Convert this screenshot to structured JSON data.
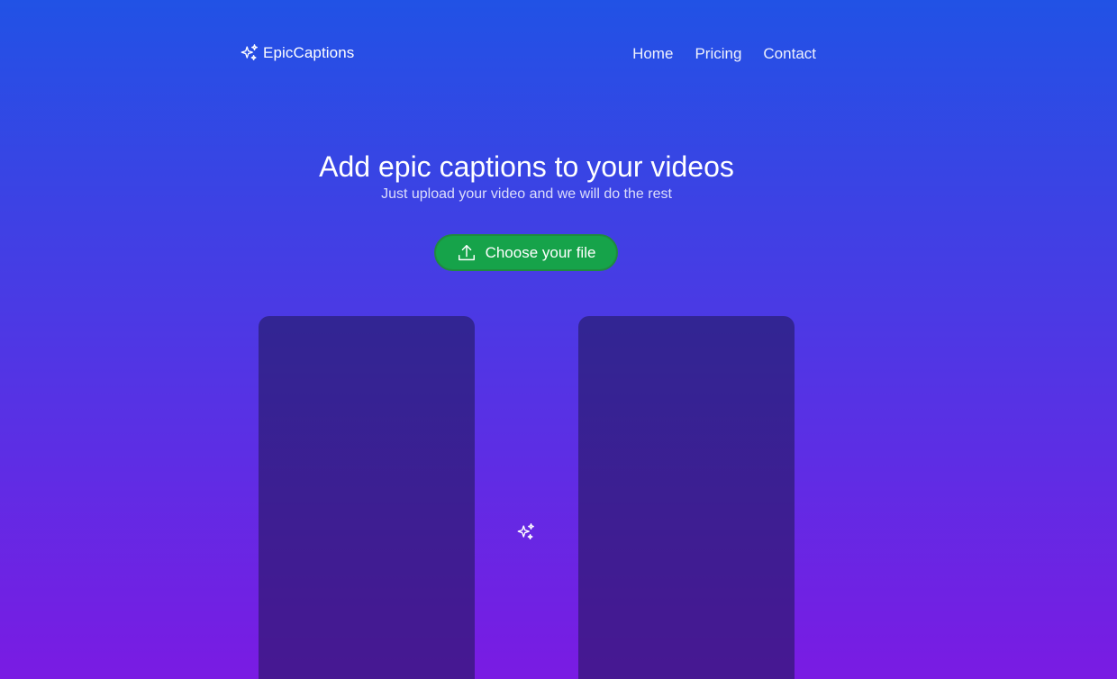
{
  "header": {
    "logo_icon": "sparkles-icon",
    "logo_text": "EpicCaptions",
    "nav": [
      {
        "label": "Home"
      },
      {
        "label": "Pricing"
      },
      {
        "label": "Contact"
      }
    ]
  },
  "hero": {
    "title": "Add epic captions to your videos",
    "subtitle": "Just upload your video and we will do the rest"
  },
  "upload": {
    "icon": "upload-icon",
    "label": "Choose your file"
  },
  "preview": {
    "divider_icon": "sparkles-icon"
  },
  "colors": {
    "background_top": "#2152e5",
    "background_bottom": "#7a1be3",
    "button_green": "#16a34a",
    "panel": "#2f2a7a"
  }
}
